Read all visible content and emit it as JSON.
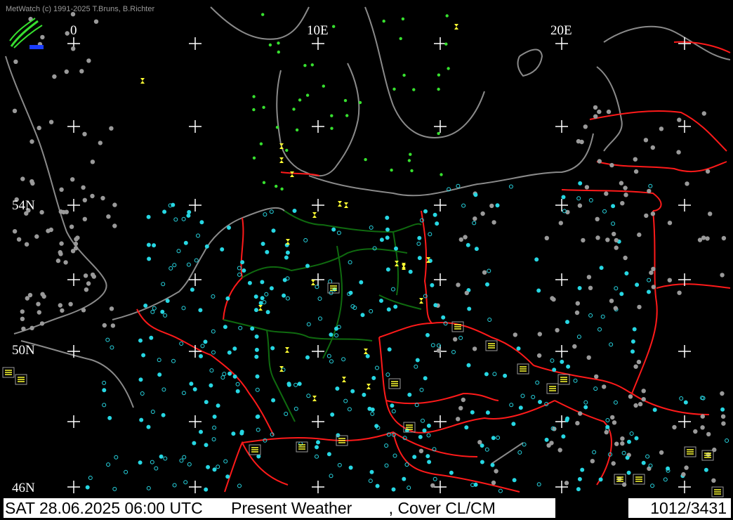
{
  "copyright": "MetWatch  (c) 1991-2025 T.Bruns, B.Richter",
  "coordinates": {
    "lon_0": "0",
    "lon_10": "10E",
    "lon_20": "20E",
    "lat_54": "54N",
    "lat_50": "50N",
    "lat_46": "46N"
  },
  "status_bar": {
    "datetime": "SAT 28.06.2025 06:00 UTC",
    "layer": "Present Weather",
    "cover": ", Cover CL/CM",
    "station_count": "1012/3431"
  },
  "colors": {
    "coast": "#8a8a8a",
    "border": "#ff1a1a",
    "state_border": "#0f6a0f",
    "cyan": "#27d7e3",
    "green": "#37e02f",
    "yellow": "#ffff33",
    "grid": "#ffffff"
  },
  "icons": {
    "logo": "metwatch-logo-icon",
    "clear": "circle-station-icon",
    "partly": "partly-cloud-icon",
    "haze": "haze-icon",
    "fog": "fog-icon",
    "drizzle": "drizzle-icon",
    "smoke": "smoke-icon"
  }
}
